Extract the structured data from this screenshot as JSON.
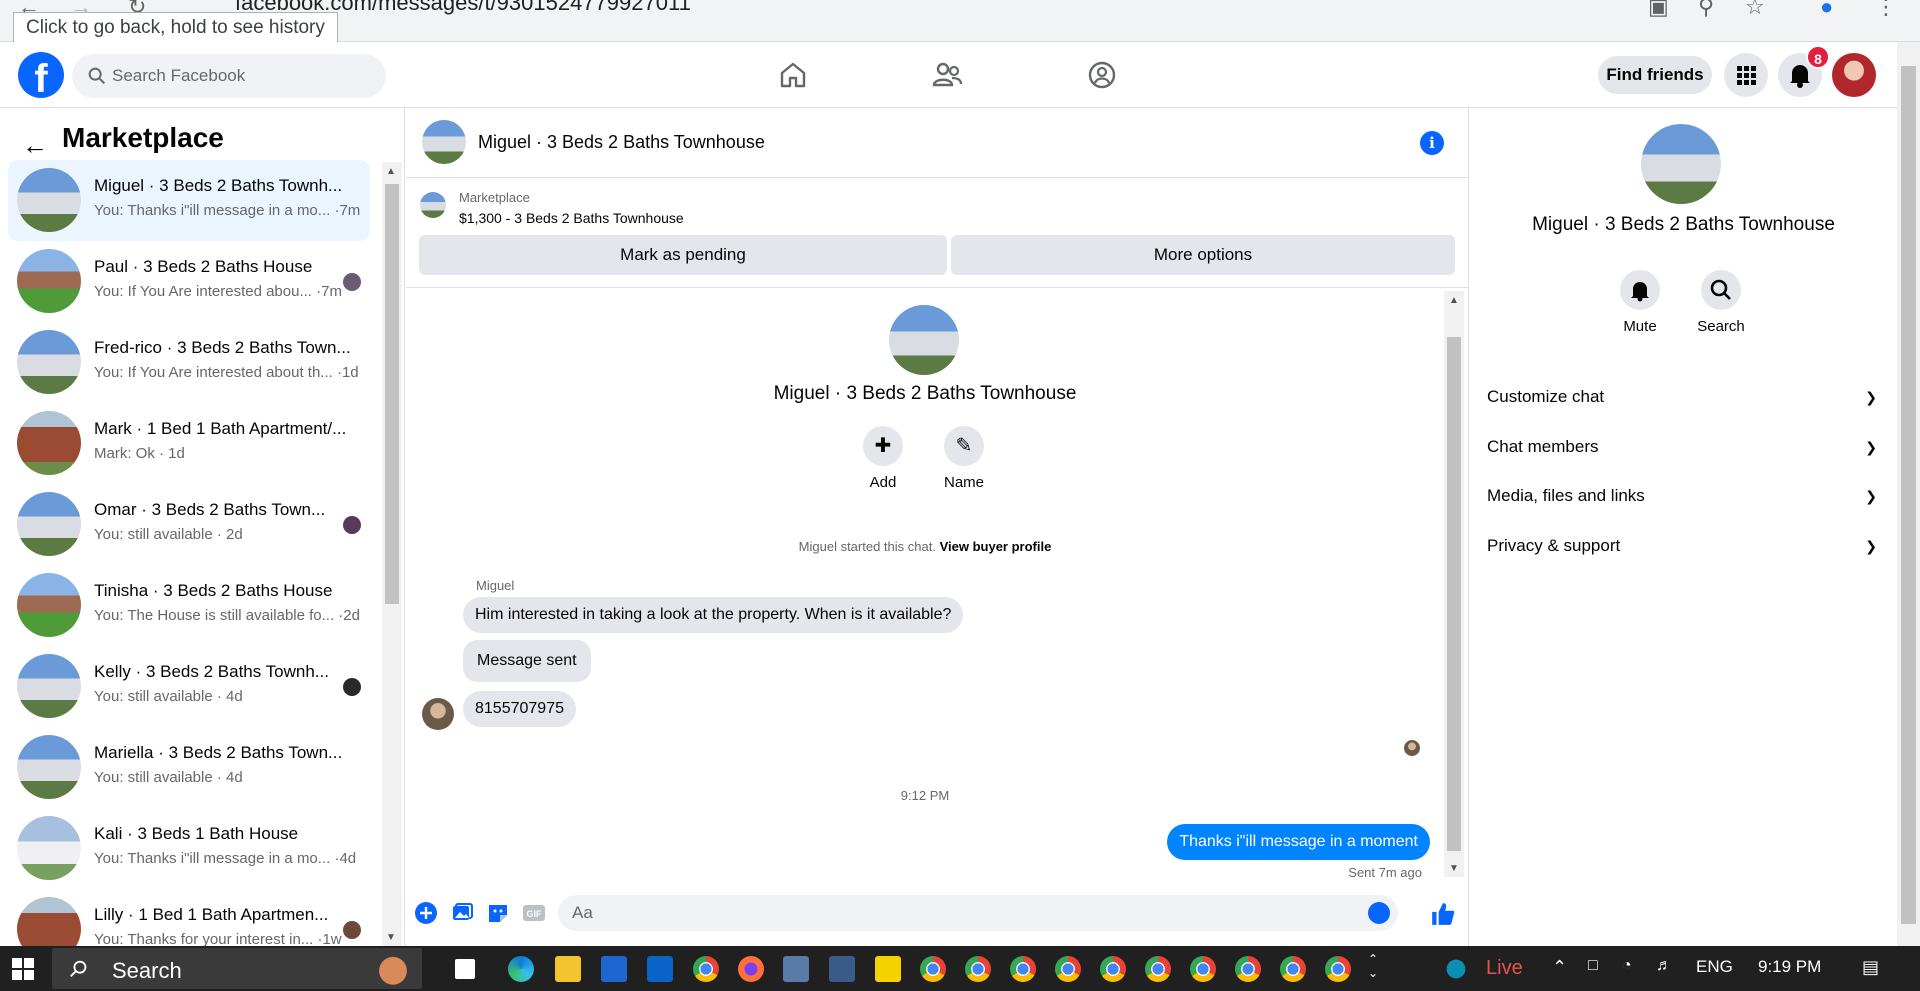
{
  "browser": {
    "url": "facebook.com/messages/t/9301524779927011",
    "tooltip": "Click to go back, hold to see history"
  },
  "topnav": {
    "search_placeholder": "Search Facebook",
    "find_friends": "Find friends",
    "notification_count": "8"
  },
  "sidebar": {
    "title": "Marketplace",
    "chats": [
      {
        "name": "Miguel · 3 Beds 2 Baths Townh...",
        "preview": "You: Thanks i\"ill message in a mo... ·7m",
        "thumb": "house-blue",
        "active": true
      },
      {
        "name": "Paul · 3 Beds 2 Baths House",
        "preview": "You: If You Are interested abou... ·7m",
        "thumb": "house-green",
        "seen": "#6b5a72"
      },
      {
        "name": "Fred-rico · 3 Beds 2 Baths Town...",
        "preview": "You: If You Are interested about th... ·1d",
        "thumb": "house-blue"
      },
      {
        "name": "Mark · 1 Bed 1 Bath Apartment/...",
        "preview": "Mark: Ok · 1d",
        "thumb": "house-brick"
      },
      {
        "name": "Omar · 3 Beds 2 Baths Town...",
        "preview": "You: still available · 2d",
        "thumb": "house-blue",
        "seen": "#5a3a5a"
      },
      {
        "name": "Tinisha · 3 Beds 2 Baths House",
        "preview": "You: The House is still available fo... ·2d",
        "thumb": "house-green"
      },
      {
        "name": "Kelly · 3 Beds 2 Baths Townh...",
        "preview": "You: still available · 4d",
        "thumb": "house-blue",
        "seen": "#2a2a2a"
      },
      {
        "name": "Mariella · 3 Beds 2 Baths Town...",
        "preview": "You: still available · 4d",
        "thumb": "house-blue"
      },
      {
        "name": "Kali · 3 Beds 1 Bath House",
        "preview": "You: Thanks i\"ill message in a mo... ·4d",
        "thumb": "house-grey"
      },
      {
        "name": "Lilly · 1 Bed 1 Bath Apartmen...",
        "preview": "You: Thanks for your interest in... ·1w",
        "thumb": "house-brick",
        "seen": "#6b4a3a"
      }
    ]
  },
  "chat": {
    "title": "Miguel · 3 Beds 2 Baths Townhouse",
    "listing_label": "Marketplace",
    "listing_title": "$1,300 - 3 Beds 2 Baths Townhouse",
    "mark_pending": "Mark as pending",
    "more_options": "More options",
    "center_name": "Miguel · 3 Beds 2 Baths Townhouse",
    "add_label": "Add",
    "name_label": "Name",
    "started_text": "Miguel started this chat.",
    "view_profile": "View buyer profile",
    "sender": "Miguel",
    "messages": [
      "Him interested in taking a look at the property. When is it available?",
      "Message sent",
      "8155707975"
    ],
    "time": "9:12 PM",
    "my_message": "Thanks i\"ill message in a moment",
    "sent_status": "Sent 7m ago",
    "composer_placeholder": "Aa"
  },
  "rpanel": {
    "name": "Miguel · 3 Beds 2 Baths Townhouse",
    "mute": "Mute",
    "search": "Search",
    "sections": [
      "Customize chat",
      "Chat members",
      "Media, files and links",
      "Privacy & support"
    ]
  },
  "taskbar": {
    "search": "Search",
    "live": "Live",
    "lang": "ENG",
    "clock": "9:19 PM"
  },
  "colors": {
    "fb_blue": "#0866ff",
    "my_bubble": "#0084ff",
    "badge": "#e41e3f"
  }
}
